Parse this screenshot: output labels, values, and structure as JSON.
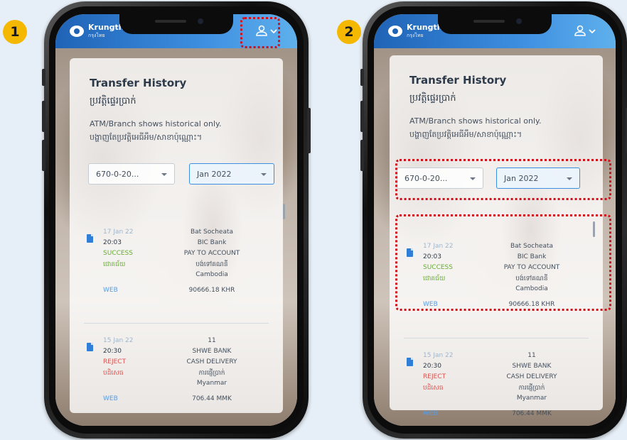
{
  "steps": [
    "1",
    "2"
  ],
  "header": {
    "brand": "Krungth",
    "brand_sub": "กรุงไทย",
    "user_icon": "user-icon",
    "menu_icon": "chevron-down-icon"
  },
  "page": {
    "title": "Transfer History",
    "title_km": "ប្រវត្តិផ្ទេរប្រាក់",
    "notice": "ATM/Branch shows historical only.",
    "notice_km": "បង្ហាញតែប្រវត្តិអេធីអឹម/សាខាប៉ុណ្ណោះ។"
  },
  "filters": {
    "account": "670-0-20...",
    "month": "Jan 2022"
  },
  "transactions": [
    {
      "date": "17 Jan 22",
      "time": "20:03",
      "status": "SUCCESS",
      "status_km": "ជោគជ័យ",
      "channel": "WEB",
      "recipient": "Bat Socheata",
      "bank": "BIC Bank",
      "type": "PAY TO ACCOUNT",
      "type_km": "បង់ទៅគណនី",
      "country": "Cambodia",
      "amount": "90666.18 KHR"
    },
    {
      "date": "15 Jan 22",
      "time": "20:30",
      "status": "REJECT",
      "status_km": "បដិសេធ",
      "channel": "WEB",
      "recipient": "11",
      "bank": "SHWE BANK",
      "type": "CASH DELIVERY",
      "type_km": "ការផ្ញើប្រាក់",
      "country": "Myanmar",
      "amount": "706.44 MMK"
    }
  ]
}
